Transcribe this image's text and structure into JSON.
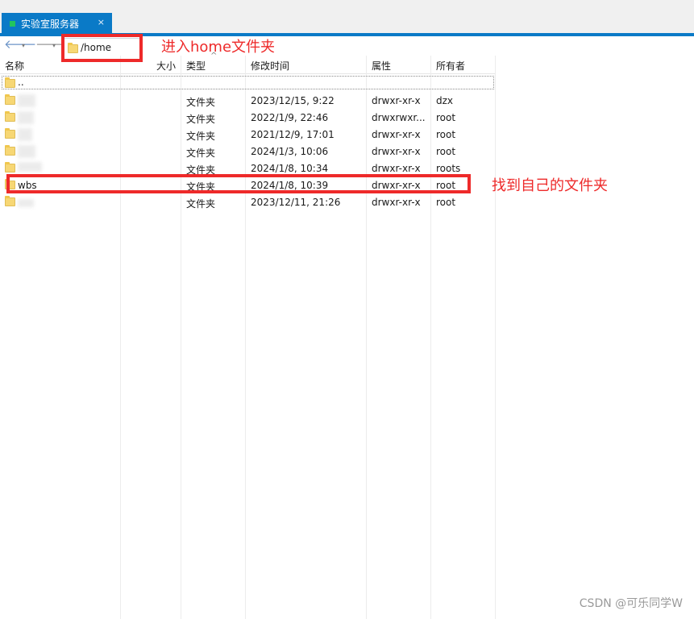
{
  "tab": {
    "title": "实验室服务器",
    "close": "×"
  },
  "nav": {
    "back": "🡐",
    "forward": "🡒",
    "dropdown": "▾"
  },
  "path": {
    "value": "/home"
  },
  "columns": {
    "name": "名称",
    "size": "大小",
    "type": "类型",
    "modified": "修改时间",
    "attrs": "属性",
    "owner": "所有者",
    "sort_indicator": "^"
  },
  "parent_row": {
    "name": ".."
  },
  "rows": [
    {
      "name": "",
      "type": "文件夹",
      "modified": "2023/12/15, 9:22",
      "attrs": "drwxr-xr-x",
      "owner": "dzx"
    },
    {
      "name": "",
      "type": "文件夹",
      "modified": "2022/1/9, 22:46",
      "attrs": "drwxrwxr...",
      "owner": "root"
    },
    {
      "name": "",
      "type": "文件夹",
      "modified": "2021/12/9, 17:01",
      "attrs": "drwxr-xr-x",
      "owner": "root"
    },
    {
      "name": "",
      "type": "文件夹",
      "modified": "2024/1/3, 10:06",
      "attrs": "drwxr-xr-x",
      "owner": "root"
    },
    {
      "name": "",
      "type": "文件夹",
      "modified": "2024/1/8, 10:34",
      "attrs": "drwxr-xr-x",
      "owner": "roots"
    },
    {
      "name": "wbs",
      "type": "文件夹",
      "modified": "2024/1/8, 10:39",
      "attrs": "drwxr-xr-x",
      "owner": "root"
    },
    {
      "name": "",
      "type": "文件夹",
      "modified": "2023/12/11, 21:26",
      "attrs": "drwxr-xr-x",
      "owner": "root"
    }
  ],
  "annotations": {
    "enter_home": "进入home文件夹",
    "find_folder": "找到自己的文件夹"
  },
  "watermark": "CSDN @可乐同学W",
  "colors": {
    "tab_active": "#0a7ac7",
    "annotation_red": "#ee2a2a",
    "folder_yellow": "#f7d774"
  }
}
